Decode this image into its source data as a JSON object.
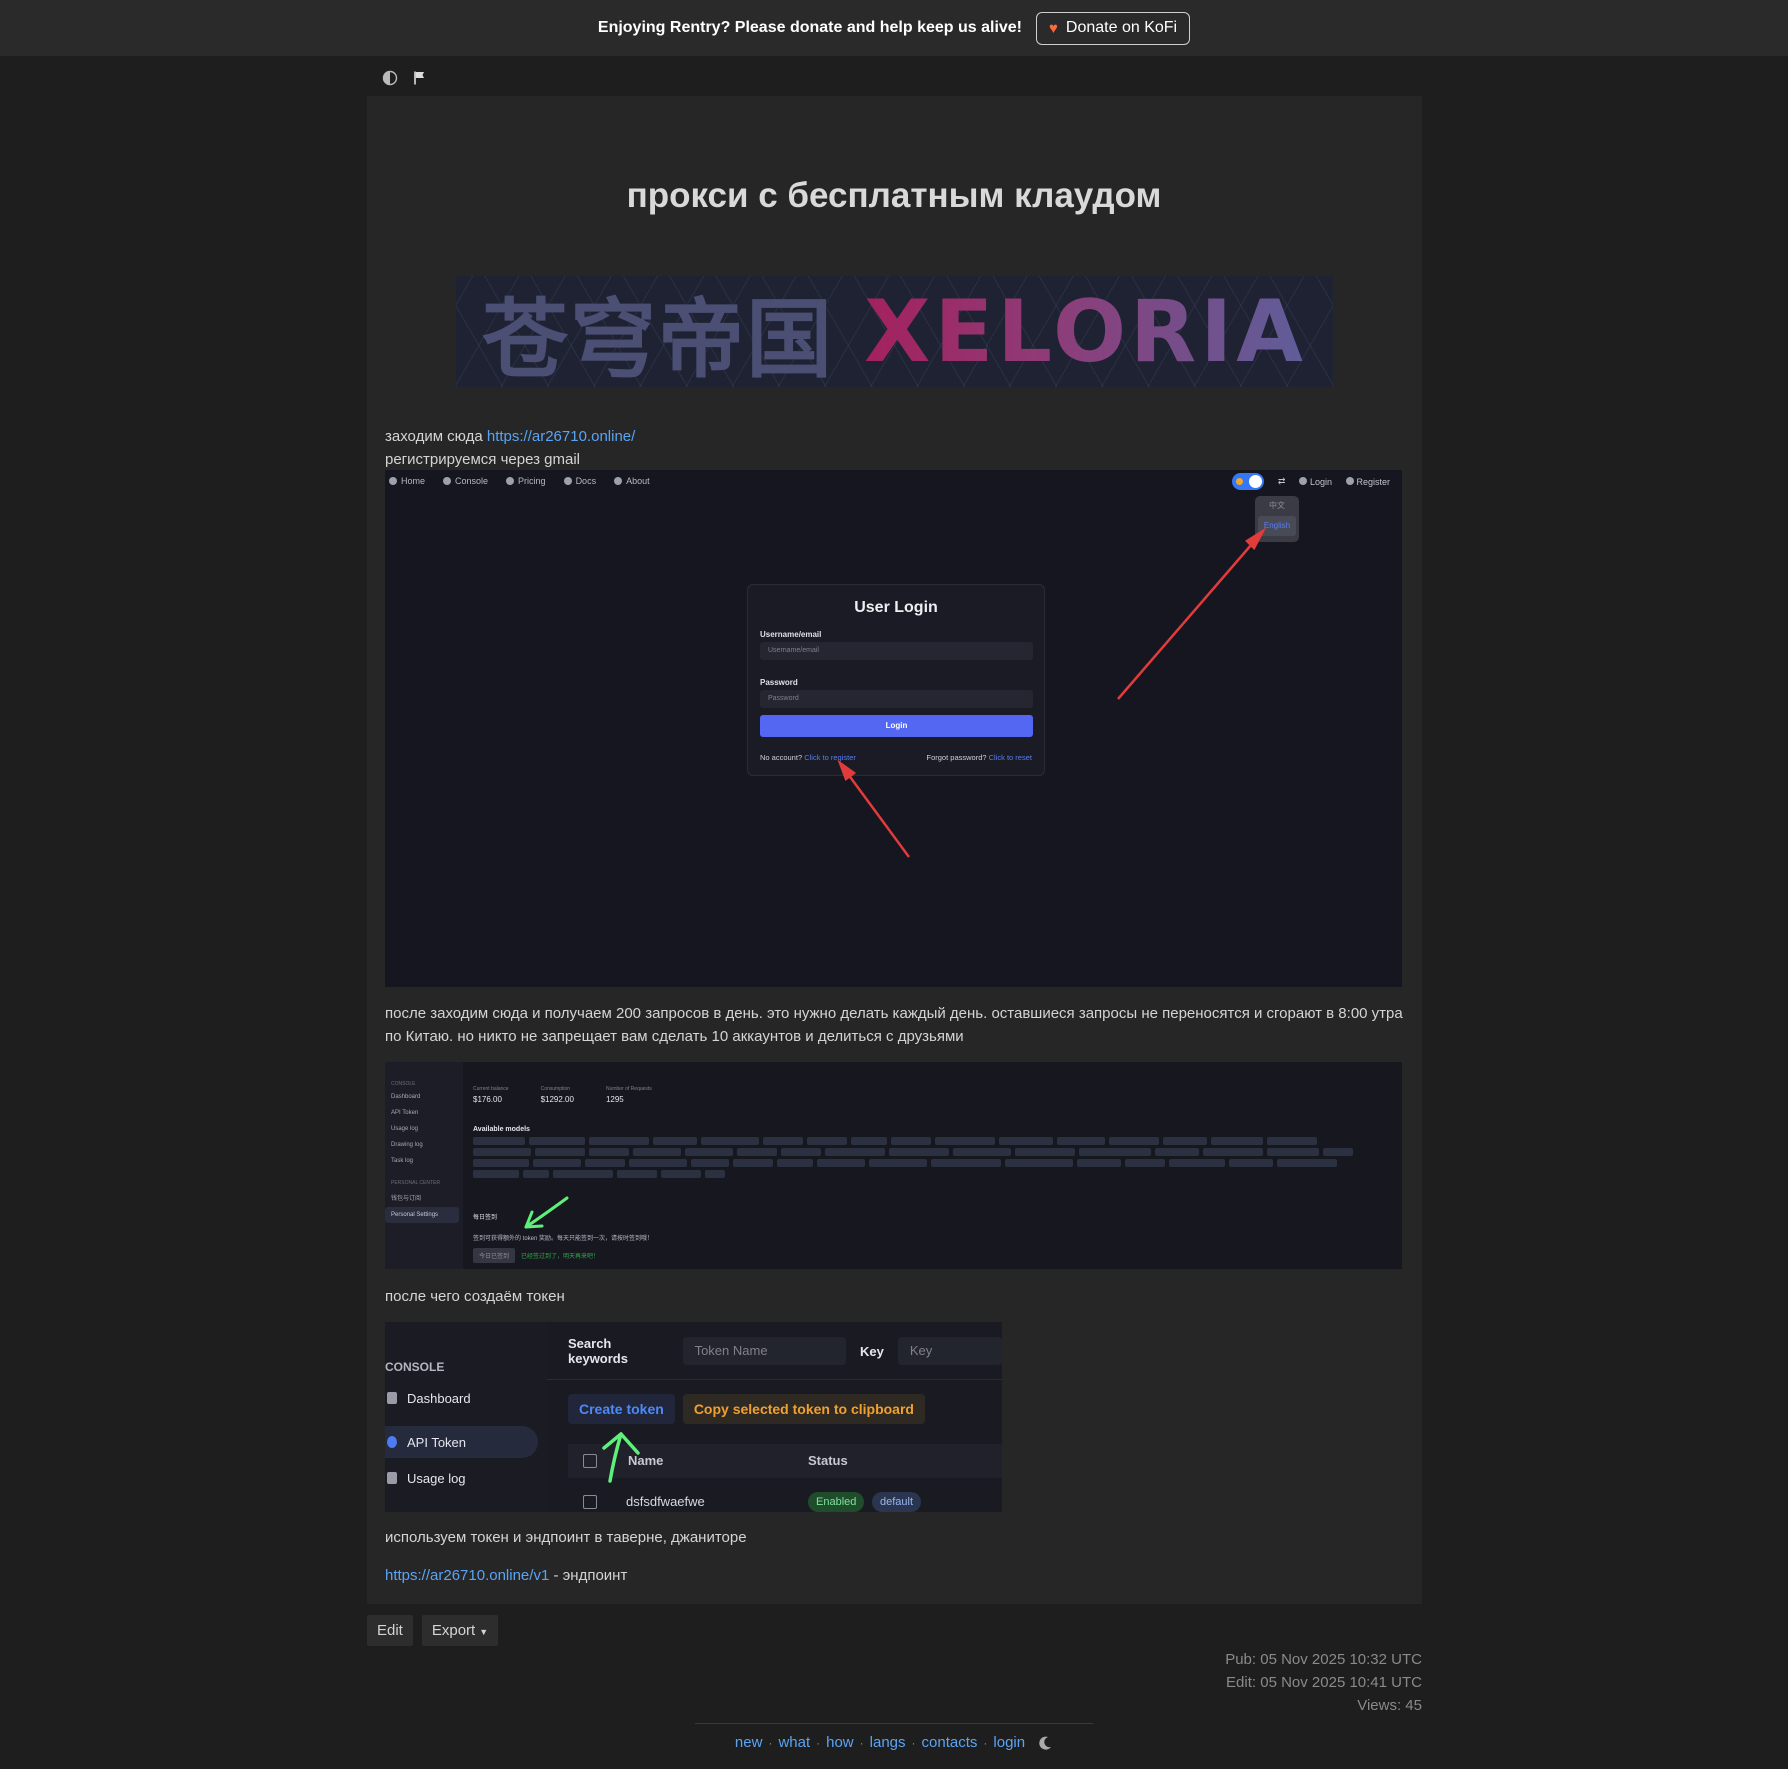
{
  "topbar": {
    "message": "Enjoying Rentry? Please donate and help keep us alive!",
    "donate_label": "Donate on KoFi"
  },
  "article": {
    "title": "прокси с бесплатным клаудом",
    "banner": {
      "cn": "苍穹帝国",
      "en": "XELORIA"
    },
    "step1_text": "заходим сюда ",
    "step1_link": "https://ar26710.online/",
    "step2_text": "регистрируемся через gmail",
    "step3_text": "после заходим сюда и получаем 200 запросов в день. это нужно делать каждый день. оставшиеся запросы не переносятся и сгорают в 8:00 утра по Китаю. но никто не запрещает вам сделать 10 аккаунтов и делиться с друзьями",
    "step4_text": "после чего создаём токен",
    "step5_text": "используем токен и эндпоинт в таверне, джаниторе",
    "endpoint_link": "https://ar26710.online/v1",
    "endpoint_suffix": " - эндпоинт"
  },
  "shot_login": {
    "nav": [
      "Home",
      "Console",
      "Pricing",
      "Docs",
      "About"
    ],
    "right_nav": [
      "Login",
      "Register"
    ],
    "lang_options": [
      "中文",
      "English"
    ],
    "card_title": "User Login",
    "username_label": "Username/email",
    "username_placeholder": "Username/email",
    "password_label": "Password",
    "password_placeholder": "Password",
    "login_button": "Login",
    "no_account": "No account? ",
    "register_link": "Click to register",
    "forgot": "Forgot password? ",
    "reset_link": "Click to reset"
  },
  "shot_dashboard": {
    "sidebar": {
      "console_section": "CONSOLE",
      "items": [
        "Dashboard",
        "API Token",
        "Usage log",
        "Drawing log",
        "Task log"
      ],
      "personal_section": "PERSONAL CENTER",
      "personal_items": [
        "钱包与订阅",
        "Personal Settings"
      ]
    },
    "stats": [
      {
        "label": "Current balance",
        "value": "$176.00"
      },
      {
        "label": "Consumption",
        "value": "$1292.00"
      },
      {
        "label": "Number of Requests",
        "value": "1295"
      }
    ],
    "models_heading": "Available models",
    "daily_title": "每日签到",
    "daily_desc": "签到可获得额外的 token 奖励。每天只能签到一次，请按时签到哦！",
    "daily_button": "今日已签到",
    "daily_status": "已经签过到了，明天再来吧！"
  },
  "shot_token": {
    "section": "CONSOLE",
    "sidebar_items": [
      "Dashboard",
      "API Token",
      "Usage log"
    ],
    "search_label": "Search keywords",
    "token_name_placeholder": "Token Name",
    "key_label": "Key",
    "key_placeholder": "Key",
    "create_button": "Create token",
    "copy_button": "Copy selected token to clipboard",
    "col_name": "Name",
    "col_status": "Status",
    "row_name": "dsfsdfwaefwe",
    "row_status": "Enabled",
    "row_group": "default"
  },
  "actions": {
    "edit": "Edit",
    "export": "Export"
  },
  "meta": {
    "pub": "Pub: 05 Nov 2025 10:32 UTC",
    "edit": "Edit: 05 Nov 2025 10:41 UTC",
    "views": "Views: 45"
  },
  "footer": {
    "links": [
      "new",
      "what",
      "how",
      "langs",
      "contacts",
      "login"
    ]
  },
  "colors": {
    "link": "#5aa4f5",
    "arrow_red": "#e23b3b",
    "arrow_green": "#5ef07a",
    "login_button": "#5467f2"
  }
}
